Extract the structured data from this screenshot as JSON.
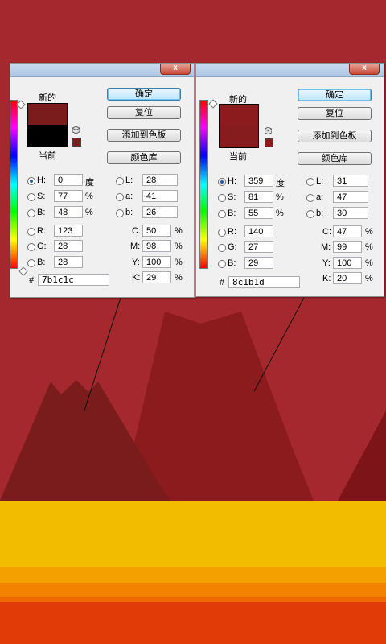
{
  "colors": {
    "background": "#a4282d",
    "mountain_dark": "#7b1c1c",
    "mountain_mid": "#8c1b1d",
    "mountain_right": "#7d1418",
    "band_yellow": "#f2bd00",
    "band_orange1": "#f4a100",
    "band_orange2": "#f28200",
    "band_orange3": "#ee6a00",
    "band_red": "#e13b08"
  },
  "dialog_left": {
    "new_label": "新的",
    "current_label": "当前",
    "new_swatch_color": "#7b1c1c",
    "ok_button": "确定",
    "reset_button": "复位",
    "add_swatch_button": "添加到色板",
    "color_library_button": "颜色库",
    "h": {
      "label": "H:",
      "value": "0",
      "unit": "度"
    },
    "s": {
      "label": "S:",
      "value": "77",
      "unit": "%"
    },
    "b": {
      "label": "B:",
      "value": "48",
      "unit": "%"
    },
    "r": {
      "label": "R:",
      "value": "123"
    },
    "g": {
      "label": "G:",
      "value": "28"
    },
    "bl": {
      "label": "B:",
      "value": "28"
    },
    "lab_l": {
      "label": "L:",
      "value": "28"
    },
    "lab_a": {
      "label": "a:",
      "value": "41"
    },
    "lab_b": {
      "label": "b:",
      "value": "26"
    },
    "c": {
      "label": "C:",
      "value": "50",
      "unit": "%"
    },
    "m": {
      "label": "M:",
      "value": "98",
      "unit": "%"
    },
    "y": {
      "label": "Y:",
      "value": "100",
      "unit": "%"
    },
    "k": {
      "label": "K:",
      "value": "29",
      "unit": "%"
    },
    "hex_label": "#",
    "hex": "7b1c1c"
  },
  "dialog_right": {
    "new_label": "新的",
    "current_label": "当前",
    "new_swatch_color": "#8c1b1d",
    "ok_button": "确定",
    "reset_button": "复位",
    "add_swatch_button": "添加到色板",
    "color_library_button": "颜色库",
    "h": {
      "label": "H:",
      "value": "359",
      "unit": "度"
    },
    "s": {
      "label": "S:",
      "value": "81",
      "unit": "%"
    },
    "b": {
      "label": "B:",
      "value": "55",
      "unit": "%"
    },
    "r": {
      "label": "R:",
      "value": "140"
    },
    "g": {
      "label": "G:",
      "value": "27"
    },
    "bl": {
      "label": "B:",
      "value": "29"
    },
    "lab_l": {
      "label": "L:",
      "value": "31"
    },
    "lab_a": {
      "label": "a:",
      "value": "47"
    },
    "lab_b": {
      "label": "b:",
      "value": "30"
    },
    "c": {
      "label": "C:",
      "value": "47",
      "unit": "%"
    },
    "m": {
      "label": "M:",
      "value": "99",
      "unit": "%"
    },
    "y": {
      "label": "Y:",
      "value": "100",
      "unit": "%"
    },
    "k": {
      "label": "K:",
      "value": "20",
      "unit": "%"
    },
    "hex_label": "#",
    "hex": "8c1b1d"
  },
  "icons": {
    "close": "close-icon",
    "cube": "web-safe-cube-icon",
    "warning": "out-of-gamut-swatch"
  }
}
